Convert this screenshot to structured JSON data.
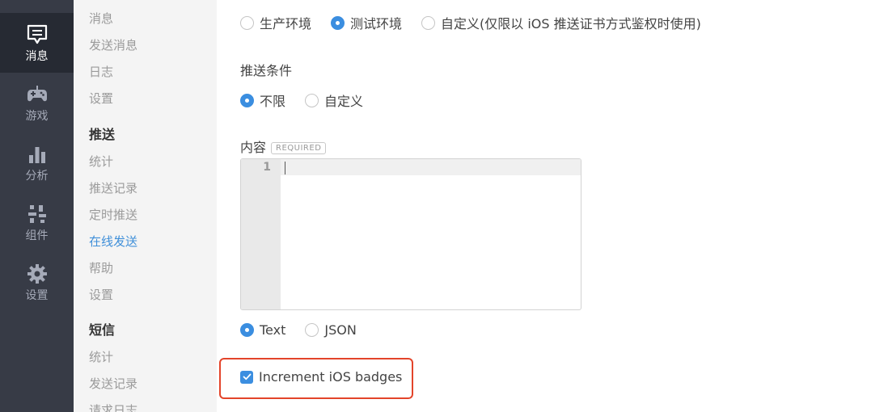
{
  "rail": {
    "items": [
      {
        "label": "消息",
        "icon": "message-icon",
        "active": true
      },
      {
        "label": "游戏",
        "icon": "gamepad-icon",
        "active": false
      },
      {
        "label": "分析",
        "icon": "bar-chart-icon",
        "active": false
      },
      {
        "label": "组件",
        "icon": "components-icon",
        "active": false
      },
      {
        "label": "设置",
        "icon": "gear-icon",
        "active": false
      }
    ]
  },
  "subnav": {
    "message_items": [
      "消息",
      "发送消息",
      "日志",
      "设置"
    ],
    "push_heading": "推送",
    "push_items": [
      "统计",
      "推送记录",
      "定时推送",
      "在线发送",
      "帮助",
      "设置"
    ],
    "sms_heading": "短信",
    "sms_items": [
      "统计",
      "发送记录",
      "请求日志"
    ],
    "active_item": "在线发送"
  },
  "form": {
    "environment": {
      "options": [
        "生产环境",
        "测试环境",
        "自定义(仅限以 iOS 推送证书方式鉴权时使用)"
      ],
      "selected": "测试环境"
    },
    "condition": {
      "label": "推送条件",
      "options": [
        "不限",
        "自定义"
      ],
      "selected": "不限"
    },
    "content": {
      "label": "内容",
      "required_badge": "REQUIRED",
      "line_number": "1",
      "value": ""
    },
    "format": {
      "options": [
        "Text",
        "JSON"
      ],
      "selected": "Text"
    },
    "badges_checkbox": {
      "label": "Increment iOS badges",
      "checked": true
    }
  },
  "colors": {
    "rail_bg": "#373b46",
    "rail_active_bg": "#262a33",
    "accent": "#3b8ee0",
    "link_active": "#3f8fd9",
    "highlight": "#e3442a"
  }
}
